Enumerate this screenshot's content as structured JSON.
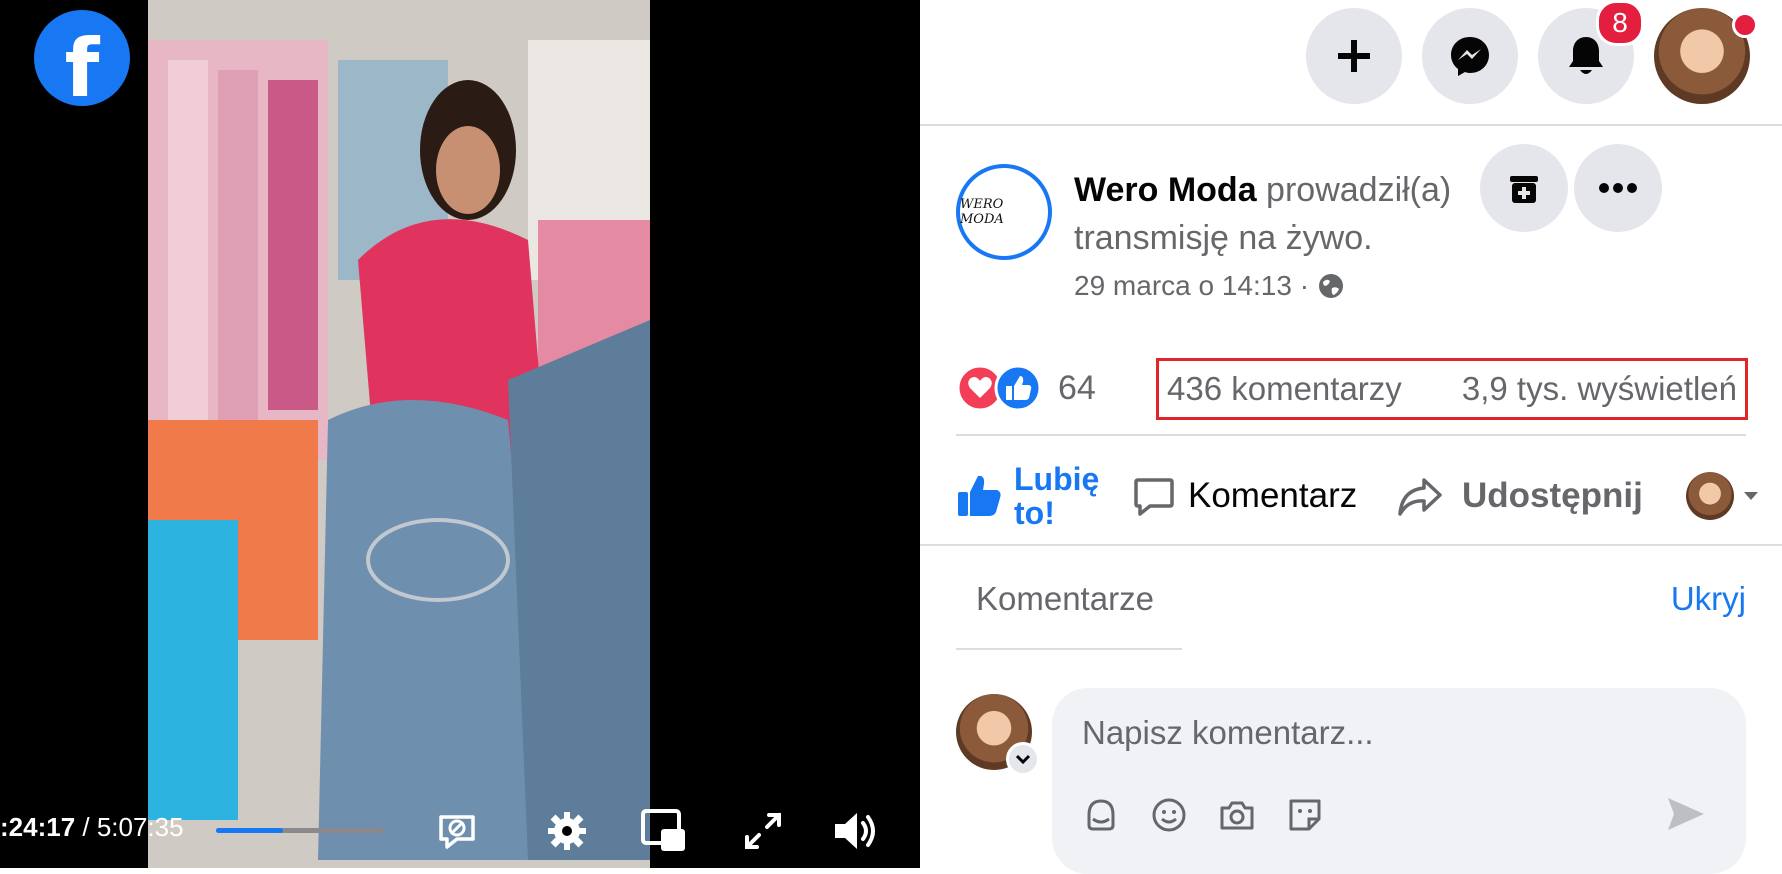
{
  "video": {
    "current_time": ":24:17",
    "separator": " / ",
    "duration": "5:07:35",
    "progress_fraction": 0.4,
    "progress_color": "#1877f2"
  },
  "brand": {
    "logo_letter": "f",
    "accent_color": "#1877f2"
  },
  "topbar": {
    "create_icon": "plus-icon",
    "messenger_icon": "messenger-icon",
    "notifications_icon": "bell-icon",
    "notifications_count": "8",
    "badge_color": "#e41e3f"
  },
  "post": {
    "page_logo_text": "WERO MODA",
    "page_name": "Wero Moda",
    "action_text": " prowadził(a) transmisję na żywo.",
    "date": "29 marca o 14:13 ·",
    "audience_icon": "globe-icon"
  },
  "stats": {
    "reaction_count": "64",
    "comments": "436 komentarzy",
    "views": "3,9 tys. wyświetleń",
    "highlight_color": "#e0252a"
  },
  "actions": {
    "like_label": "Lubię to!",
    "comment_label": "Komentarz",
    "share_label": "Udostępnij"
  },
  "comments": {
    "tab_label": "Komentarze",
    "hide_label": "Ukryj",
    "input_placeholder": "Napisz komentarz..."
  }
}
